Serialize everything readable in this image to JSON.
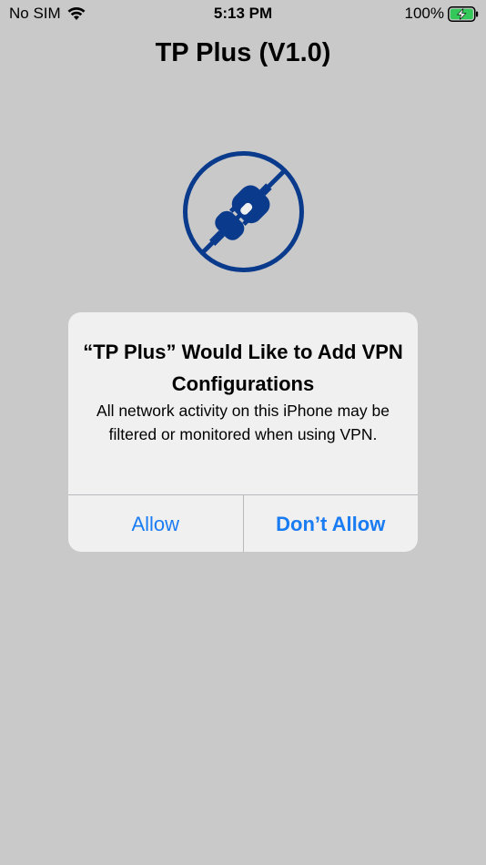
{
  "status_bar": {
    "carrier": "No SIM",
    "time": "5:13 PM",
    "battery": "100%"
  },
  "app": {
    "title": "TP Plus (V1.0)",
    "logo_icon": "unplugged-plug-icon",
    "logo_color": "#0a3a8c"
  },
  "alert": {
    "title": "“TP Plus” Would Like to Add VPN Configurations",
    "message": "All network activity on this iPhone may be filtered or monitored when using VPN.",
    "allow_label": "Allow",
    "dont_allow_label": "Don’t Allow",
    "button_color": "#1a7cf2"
  }
}
